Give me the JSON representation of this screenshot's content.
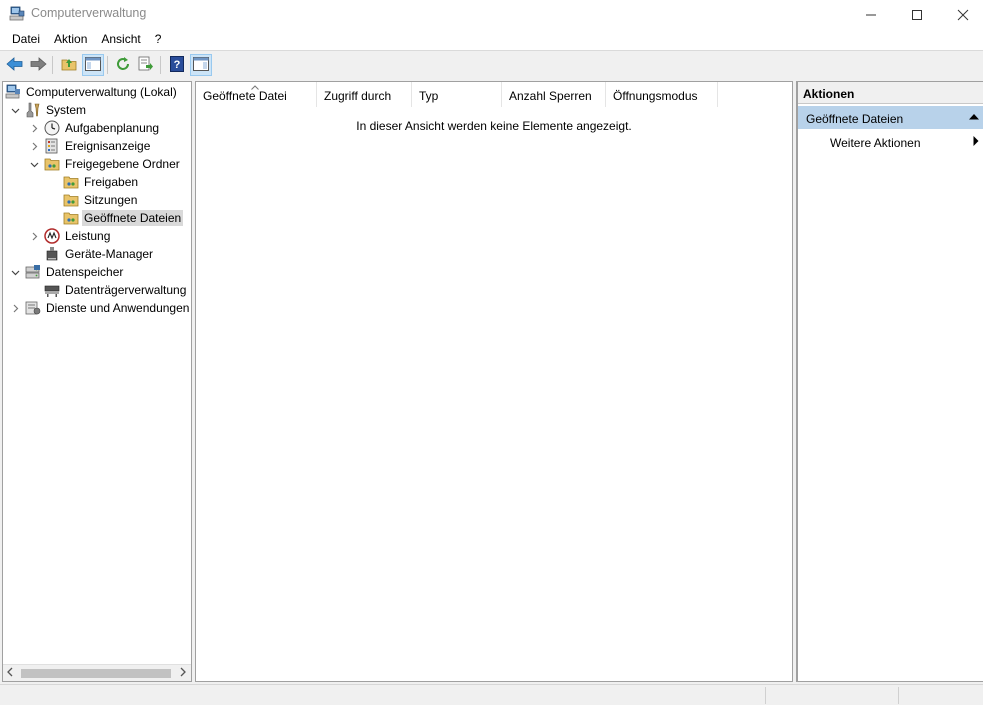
{
  "window": {
    "title": "Computerverwaltung"
  },
  "menu": [
    "Datei",
    "Aktion",
    "Ansicht",
    "?"
  ],
  "toolbar": {
    "icons": [
      "back-arrow-icon",
      "forward-arrow-icon",
      "up-folder-icon",
      "show-hide-console-tree-icon",
      "refresh-icon",
      "export-list-icon",
      "help-icon",
      "show-hide-action-pane-icon"
    ]
  },
  "tree": {
    "root": "Computerverwaltung (Lokal)",
    "system": "System",
    "aufgabenplanung": "Aufgabenplanung",
    "ereignisanzeige": "Ereignisanzeige",
    "freigegebene_ordner": "Freigegebene Ordner",
    "freigaben": "Freigaben",
    "sitzungen": "Sitzungen",
    "geoeffnete_dateien": "Geöffnete Dateien",
    "leistung": "Leistung",
    "geraete_manager": "Geräte-Manager",
    "datenspeicher": "Datenspeicher",
    "datentraegerverwaltung": "Datenträgerverwaltung",
    "dienste": "Dienste und Anwendungen"
  },
  "list": {
    "columns": [
      "Geöffnete Datei",
      "Zugriff durch",
      "Typ",
      "Anzahl Sperren",
      "Öffnungsmodus"
    ],
    "empty_message": "In dieser Ansicht werden keine Elemente angezeigt."
  },
  "actions": {
    "header": "Aktionen",
    "section": "Geöffnete Dateien",
    "items": [
      "Weitere Aktionen"
    ]
  },
  "colors": {
    "selection": "#d9d9d9",
    "action_section": "#b8d2ea",
    "pane_border": "#a0a0a0"
  }
}
